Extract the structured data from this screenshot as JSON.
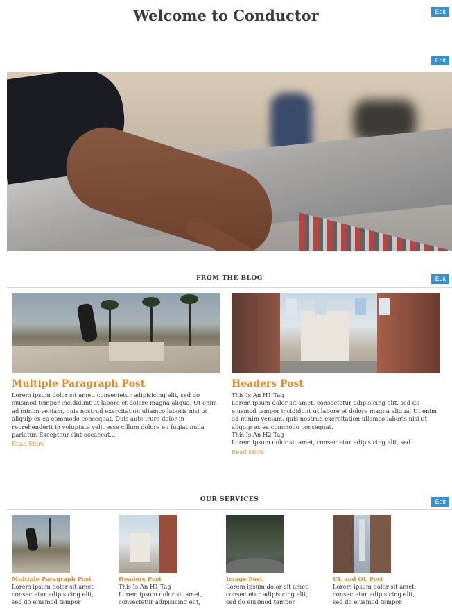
{
  "header": {
    "title": "Welcome to Conductor",
    "edit_label": "Edit"
  },
  "hero": {
    "edit_label": "Edit"
  },
  "blog": {
    "heading": "FROM THE BLOG",
    "edit_label": "Edit",
    "posts": [
      {
        "title": "Multiple Paragraph Post",
        "body": "Lorem ipsum dolor sit amet, consectetur adipisicing elit, sed do eiusmod tempor incididunt ut labore et dolore magna aliqua. Ut enim ad minim veniam, quis nostrud exercitation ullamco laboris nisi ut aliquip ex ea commodo consequat. Duis aute irure dolor in reprehenderit in voluptate velit esse cillum dolore eu fugiat nulla pariatur. Excepteur sint occaecat…",
        "read_more": "Read More"
      },
      {
        "title": "Headers Post",
        "h1": "This Is An H1 Tag",
        "body1": "Lorem ipsum dolor sit amet, consectetur adipisicing elit, sed do eiusmod tempor incididunt ut labore et dolore magna aliqua. Ut enim ad minim veniam, quis nostrud exercitation ullamco laboris nisi ut aliquip ex ea commodo consequat.",
        "h2": "This Is An H2 Tag",
        "body2": "Lorem ipsum dolor sit amet, consectetur adipisicing elit, sed…",
        "read_more": "Read More"
      }
    ]
  },
  "services": {
    "heading": "OUR SERVICES",
    "edit_label": "Edit",
    "items": [
      {
        "title": "Multiple Paragraph Post",
        "line1": "Lorem ipsum dolor sit amet,",
        "line2": "consectetur adipisicing elit,",
        "line3": "sed do eiusmod tempor"
      },
      {
        "title": "Headers Post",
        "line1": "This Is An H1 Tag",
        "line2": "Lorem ipsum dolor sit amet,",
        "line3": "consectetur adipisicing elit,"
      },
      {
        "title": "Image Post",
        "line1": "Lorem ipsum dolor sit amet,",
        "line2": "consectetur adipisicing elit,",
        "line3": "sed do eiusmod tempor"
      },
      {
        "title": "UL and OL Post",
        "line1": "Lorem ipsum dolor sit amet,",
        "line2": "consectetur adipisicing elit,",
        "line3": "sed do eiusmod tempor"
      }
    ]
  },
  "colors": {
    "accent": "#e08a2e",
    "edit_button": "#3a8fd1",
    "title_text": "#3b3b3b",
    "rule": "#d9d9d9"
  }
}
